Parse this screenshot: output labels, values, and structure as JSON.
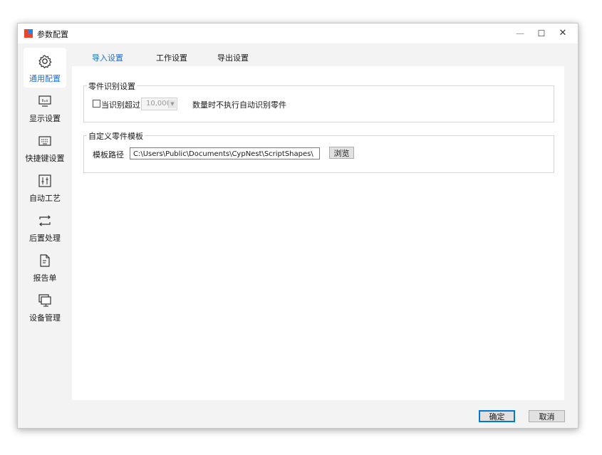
{
  "window": {
    "title": "参数配置"
  },
  "sidebar": {
    "items": [
      {
        "label": "通用配置",
        "icon": "gear-icon",
        "active": true
      },
      {
        "label": "显示设置",
        "icon": "display-icon"
      },
      {
        "label": "快捷键设置",
        "icon": "keyboard-icon"
      },
      {
        "label": "自动工艺",
        "icon": "sliders-icon"
      },
      {
        "label": "后置处理",
        "icon": "loop-arrows-icon"
      },
      {
        "label": "报告单",
        "icon": "document-icon"
      },
      {
        "label": "设备管理",
        "icon": "monitor-icon"
      }
    ]
  },
  "tabs": [
    {
      "label": "导入设置",
      "active": true
    },
    {
      "label": "工作设置"
    },
    {
      "label": "导出设置"
    }
  ],
  "part_recognition": {
    "title": "零件识别设置",
    "checkbox_label": "当识别超过",
    "threshold_value": "10,000",
    "suffix": "数量时不执行自动识别零件",
    "checked": false
  },
  "custom_template": {
    "title": "自定义零件模板",
    "path_label": "模板路径",
    "path_value": "C:\\Users\\Public\\Documents\\CypNest\\ScriptShapes\\",
    "browse_label": "浏览"
  },
  "footer": {
    "ok_label": "确定",
    "cancel_label": "取消"
  },
  "colors": {
    "accent": "#1a6fd6",
    "window_bg": "#f3f3f3",
    "panel_bg": "#ffffff"
  }
}
